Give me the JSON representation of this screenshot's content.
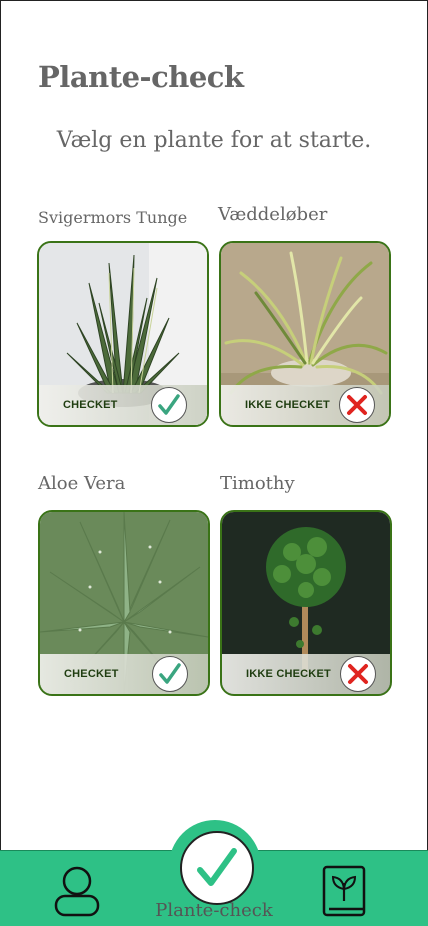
{
  "header": {
    "title": "Plante-check",
    "subtitle": "Vælg en plante for at starte."
  },
  "plants": [
    {
      "name": "Svigermors Tunge",
      "status": "CHECKET",
      "checked": true
    },
    {
      "name": "Væddeløber",
      "status": "IKKE CHECKET",
      "checked": false
    },
    {
      "name": "Aloe Vera",
      "status": "CHECKET",
      "checked": true
    },
    {
      "name": "Timothy",
      "status": "IKKE CHECKET",
      "checked": false
    }
  ],
  "nav": {
    "left_icon": "user-icon",
    "center_icon": "checkmark-icon",
    "center_label": "Plante-check",
    "right_icon": "plant-book-icon"
  },
  "colors": {
    "accent": "#2ec186",
    "card_border": "#3a7317",
    "check_green": "#3aa580",
    "cross_red": "#e0241f"
  }
}
